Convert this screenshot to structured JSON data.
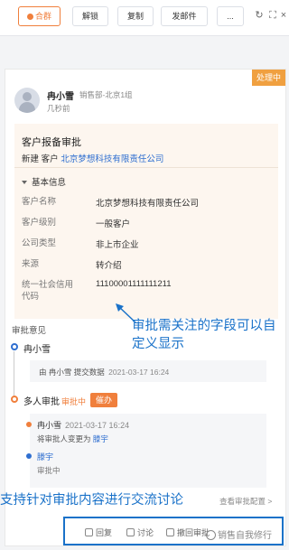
{
  "toolbar": {
    "merge_label": "合群",
    "unlock_label": "解锁",
    "copy_label": "复制",
    "send_mail_label": "发邮件",
    "more_label": "...",
    "icons": [
      "refresh-icon",
      "expand-icon",
      "close-icon"
    ]
  },
  "record": {
    "status_badge": "处理中",
    "user_name": "冉小雪",
    "department": "销售部-北京1组",
    "time_ago": "几秒前"
  },
  "approval": {
    "title": "客户报备审批",
    "action": "新建",
    "object_type": "客户",
    "object_name": "北京梦想科技有限责任公司",
    "section_title": "基本信息",
    "fields": [
      {
        "label": "客户名称",
        "value": "北京梦想科技有限责任公司"
      },
      {
        "label": "客户级别",
        "value": "一般客户"
      },
      {
        "label": "公司类型",
        "value": "非上市企业"
      },
      {
        "label": "来源",
        "value": "转介绍"
      },
      {
        "label": "统一社会信用代码",
        "value": "11100001111111211"
      }
    ]
  },
  "callouts": {
    "fields_note": "审批需关注的字段可以自定义显示",
    "discussion_note": "支持针对审批内容进行交流讨论"
  },
  "timeline": {
    "opinion_label": "审批意见",
    "submitter": "冉小雪",
    "submit_prefix": "由",
    "submit_user": "冉小雪",
    "submit_action": "提交数据",
    "submit_time": "2021-03-17 16:24",
    "multi_title": "多人审批",
    "multi_state": "审批中",
    "remind_label": "催办",
    "change_user": "冉小雪",
    "change_time": "2021-03-17 16:24",
    "change_text": "将审批人变更为",
    "change_target": "滕宇",
    "approver": "滕宇",
    "approver_status": "审批中",
    "view_config": "查看审批配置 >"
  },
  "actions": {
    "reply": "回复",
    "discuss": "讨论",
    "withdraw": "撤回审批",
    "watermark": "销售自我修行"
  },
  "colors": {
    "accent_orange": "#f07f3c",
    "link_blue": "#2f6fd0",
    "callout_blue": "#1a72c9"
  }
}
